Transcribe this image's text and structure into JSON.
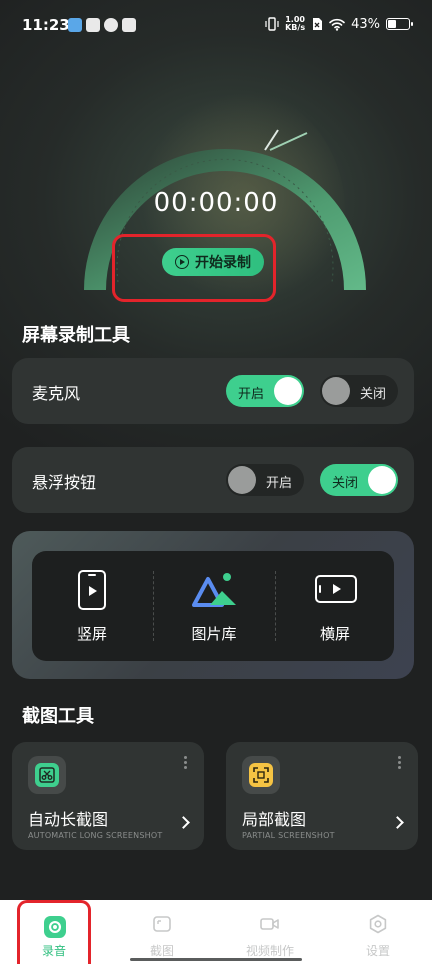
{
  "status_bar": {
    "time": "11:23",
    "net_speed_value": "1.00",
    "net_speed_unit": "KB/s",
    "battery": "43%",
    "battery_level": 0.43
  },
  "recorder": {
    "timer": "00:00:00",
    "start_label": "开始录制"
  },
  "screen_tools": {
    "title": "屏幕录制工具",
    "microphone": {
      "label": "麦克风",
      "on_label": "开启",
      "off_label": "关闭",
      "state": "on"
    },
    "floating_button": {
      "label": "悬浮按钮",
      "on_label": "开启",
      "off_label": "关闭",
      "state": "off"
    }
  },
  "modes": [
    {
      "label": "竖屏",
      "icon": "portrait-phone-icon"
    },
    {
      "label": "图片库",
      "icon": "gallery-icon"
    },
    {
      "label": "横屏",
      "icon": "landscape-phone-icon"
    }
  ],
  "screenshot_tools": {
    "title": "截图工具",
    "cards": [
      {
        "title": "自动长截图",
        "subtitle": "AUTOMATIC LONG SCREENSHOT",
        "icon": "scissors-icon",
        "color": "#3ecf8e"
      },
      {
        "title": "局部截图",
        "subtitle": "PARTIAL SCREENSHOT",
        "icon": "crop-frame-icon",
        "color": "#f5c343"
      }
    ]
  },
  "bottom_nav": [
    {
      "label": "录音",
      "icon": "record-icon",
      "active": true
    },
    {
      "label": "截图",
      "icon": "screenshot-icon",
      "active": false
    },
    {
      "label": "视频制作",
      "icon": "video-camera-icon",
      "active": false
    },
    {
      "label": "设置",
      "icon": "settings-icon",
      "active": false
    }
  ],
  "colors": {
    "accent": "#3ecf8e",
    "highlight": "#e3242b",
    "background": "#1f2121"
  }
}
